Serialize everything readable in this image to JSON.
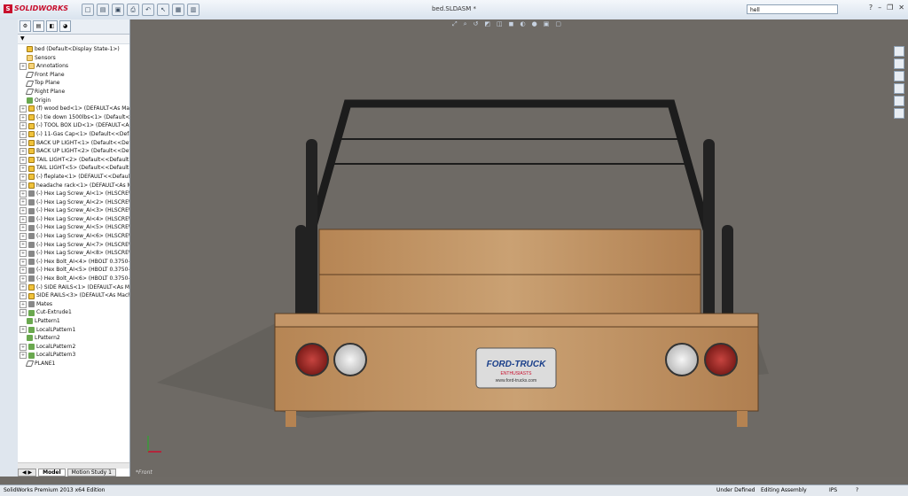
{
  "app": {
    "logo": "SOLIDWORKS",
    "doc_title": "bed.SLDASM *"
  },
  "search": {
    "value": "hell"
  },
  "feature_manager": {
    "root": "bed (Default<Display State-1>)",
    "items": [
      {
        "label": "Sensors",
        "icon": "sensor-icon",
        "expand": ""
      },
      {
        "label": "Annotations",
        "icon": "annotation-icon",
        "expand": "+"
      },
      {
        "label": "Front Plane",
        "icon": "plane-icon",
        "expand": ""
      },
      {
        "label": "Top Plane",
        "icon": "plane-icon",
        "expand": ""
      },
      {
        "label": "Right Plane",
        "icon": "plane-icon",
        "expand": ""
      },
      {
        "label": "Origin",
        "icon": "origin-icon",
        "expand": ""
      },
      {
        "label": "(f) wood bed<1> (DEFAULT<As Mac",
        "icon": "part-icon",
        "expand": "+"
      },
      {
        "label": "(-) tie down 1500lbs<1> (Default<Di",
        "icon": "part-icon",
        "expand": "+"
      },
      {
        "label": "(-) TOOL BOX LID<1> (DEFAULT<As",
        "icon": "part-icon",
        "expand": "+"
      },
      {
        "label": "(-) 11-Gas Cap<1> (Default<<Defaul",
        "icon": "part-icon",
        "expand": "+"
      },
      {
        "label": "BACK UP LIGHT<1> (Default<<Defa",
        "icon": "part-icon",
        "expand": "+"
      },
      {
        "label": "BACK UP LIGHT<2> (Default<<Defa",
        "icon": "part-icon",
        "expand": "+"
      },
      {
        "label": "TAIL LIGHT<2> (Default<<Default>_",
        "icon": "part-icon",
        "expand": "+"
      },
      {
        "label": "TAIL LIGHT<5> (Default<<Default>_",
        "icon": "part-icon",
        "expand": "+"
      },
      {
        "label": "(-) fleplate<1> (DEFAULT<<Default>",
        "icon": "part-icon",
        "expand": "+"
      },
      {
        "label": "headache rack<1> (DEFAULT<As M",
        "icon": "part-icon",
        "expand": "+"
      },
      {
        "label": "(-) Hex Lag Screw_AI<1> (HLSCREW",
        "icon": "screw-icon",
        "expand": "+"
      },
      {
        "label": "(-) Hex Lag Screw_AI<2> (HLSCREW",
        "icon": "screw-icon",
        "expand": "+"
      },
      {
        "label": "(-) Hex Lag Screw_AI<3> (HLSCREW",
        "icon": "screw-icon",
        "expand": "+"
      },
      {
        "label": "(-) Hex Lag Screw_AI<4> (HLSCREW",
        "icon": "screw-icon",
        "expand": "+"
      },
      {
        "label": "(-) Hex Lag Screw_AI<5> (HLSCREW",
        "icon": "screw-icon",
        "expand": "+"
      },
      {
        "label": "(-) Hex Lag Screw_AI<6> (HLSCREW",
        "icon": "screw-icon",
        "expand": "+"
      },
      {
        "label": "(-) Hex Lag Screw_AI<7> (HLSCREW",
        "icon": "screw-icon",
        "expand": "+"
      },
      {
        "label": "(-) Hex Lag Screw_AI<8> (HLSCREW",
        "icon": "screw-icon",
        "expand": "+"
      },
      {
        "label": "(-) Hex Bolt_AI<4> (HBOLT 0.3750-1",
        "icon": "screw-icon",
        "expand": "+"
      },
      {
        "label": "(-) Hex Bolt_AI<5> (HBOLT 0.3750-1",
        "icon": "screw-icon",
        "expand": "+"
      },
      {
        "label": "(-) Hex Bolt_AI<6> (HBOLT 0.3750-1",
        "icon": "screw-icon",
        "expand": "+"
      },
      {
        "label": "(-) SIDE RAILS<1> (DEFAULT<As Ma",
        "icon": "part-icon",
        "expand": "+"
      },
      {
        "label": "SIDE RAILS<3> (DEFAULT<As Machi",
        "icon": "part-icon",
        "expand": "+"
      },
      {
        "label": "Mates",
        "icon": "mates-icon",
        "expand": "+"
      },
      {
        "label": "Cut-Extrude1",
        "icon": "feature-icon",
        "expand": "+"
      },
      {
        "label": "LPattern1",
        "icon": "pattern-icon",
        "expand": ""
      },
      {
        "label": "LocalLPattern1",
        "icon": "pattern-icon",
        "expand": "+"
      },
      {
        "label": "LPattern2",
        "icon": "pattern-icon",
        "expand": ""
      },
      {
        "label": "LocalLPattern2",
        "icon": "pattern-icon",
        "expand": "+"
      },
      {
        "label": "LocalLPattern3",
        "icon": "pattern-icon",
        "expand": "+"
      },
      {
        "label": "PLANE1",
        "icon": "plane-icon",
        "expand": ""
      }
    ]
  },
  "tabs": {
    "model": "Model",
    "motion": "Motion Study 1"
  },
  "viewport": {
    "view_label": "*Front"
  },
  "plate": {
    "line1": "FORD-TRUCK",
    "line2": "ENTHUSIASTS",
    "line3": "www.ford-trucks.com"
  },
  "status": {
    "edition": "SolidWorks Premium 2013 x64 Edition",
    "defined": "Under Defined",
    "mode": "Editing Assembly",
    "units": "IPS"
  }
}
